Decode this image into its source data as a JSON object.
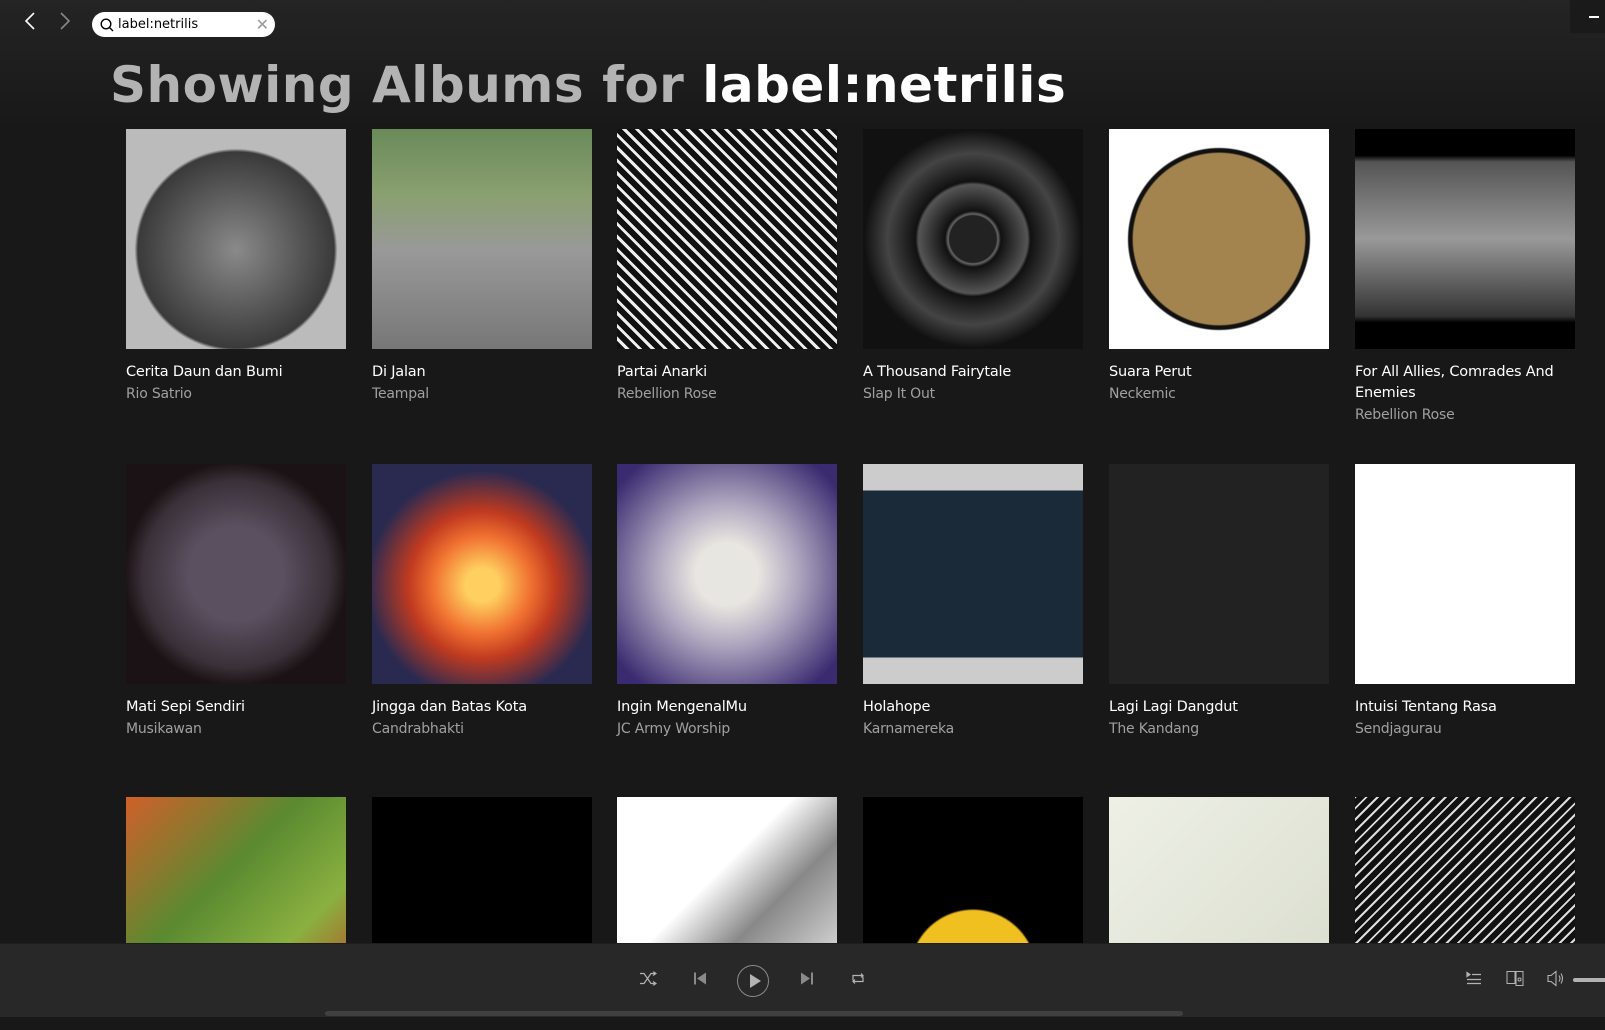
{
  "topbar": {
    "back_icon": "chevron-left-icon",
    "forward_icon": "chevron-right-icon",
    "search_value": "label:netrilis",
    "search_icon": "search-icon",
    "clear_icon": "close-icon"
  },
  "heading": {
    "prefix": "Showing Albums for ",
    "query": "label:netrilis"
  },
  "albums": [
    {
      "title": "Cerita Daun dan Bumi",
      "artist": "Rio Satrio",
      "art": "bw-photo"
    },
    {
      "title": "Di Jalan",
      "artist": "Teampal",
      "art": "street-photo"
    },
    {
      "title": "Partai Anarki",
      "artist": "Rebellion Rose",
      "art": "bw-poster"
    },
    {
      "title": "A Thousand Fairytale",
      "artist": "Slap It Out",
      "art": "mandala"
    },
    {
      "title": "Suara Perut",
      "artist": "Neckemic",
      "art": "ball-1976"
    },
    {
      "title": "For All Allies, Comrades And Enemies",
      "artist": "Rebellion Rose",
      "art": "bw-collage"
    },
    {
      "title": "Mati Sepi Sendiri",
      "artist": "Musikawan",
      "art": "dark-circle"
    },
    {
      "title": "Jingga dan Batas Kota",
      "artist": "Candrabhakti",
      "art": "sunset"
    },
    {
      "title": "Ingin MengenalMu",
      "artist": "JC Army Worship",
      "art": "purple-grunge"
    },
    {
      "title": "Holahope",
      "artist": "Karnamereka",
      "art": "forest"
    },
    {
      "title": "Lagi Lagi Dangdut",
      "artist": "The Kandang",
      "art": "dark-sketch"
    },
    {
      "title": "Intuisi Tentang Rasa",
      "artist": "Sendjagurau",
      "art": "white-script"
    },
    {
      "title": "",
      "artist": "",
      "art": "green-painting"
    },
    {
      "title": "",
      "artist": "",
      "art": "black-script"
    },
    {
      "title": "",
      "artist": "",
      "art": "lion"
    },
    {
      "title": "",
      "artist": "",
      "art": "havinhell"
    },
    {
      "title": "",
      "artist": "",
      "art": "guitar"
    },
    {
      "title": "",
      "artist": "",
      "art": "bw-poster-2"
    }
  ],
  "player": {
    "shuffle_icon": "shuffle-icon",
    "prev_icon": "skip-back-icon",
    "play_icon": "play-icon",
    "next_icon": "skip-forward-icon",
    "repeat_icon": "repeat-icon",
    "queue_icon": "queue-icon",
    "devices_icon": "devices-icon",
    "volume_icon": "volume-icon"
  }
}
